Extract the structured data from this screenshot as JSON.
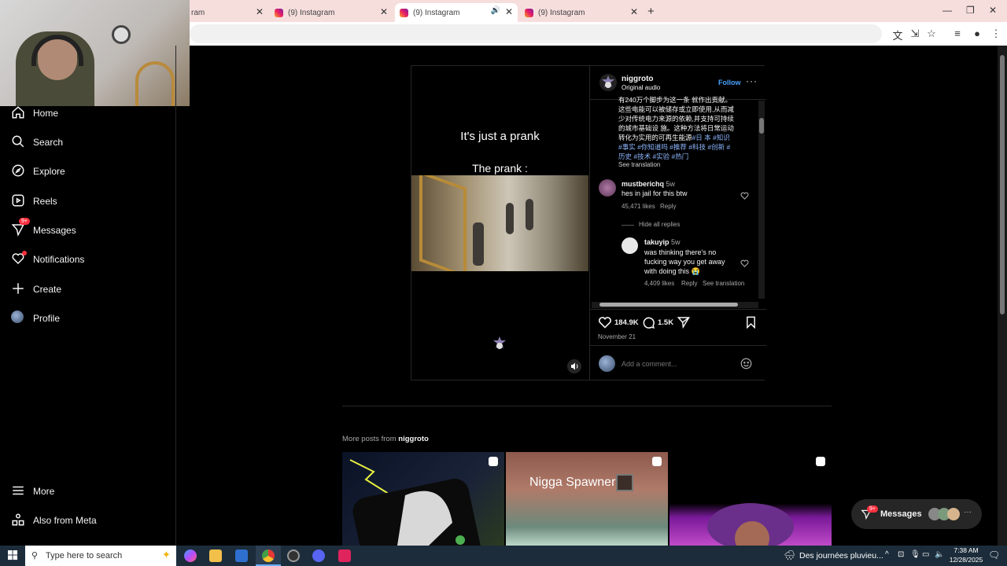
{
  "browser": {
    "tabs": [
      {
        "label": "ram"
      },
      {
        "label": "(9) Instagram"
      },
      {
        "label": "(9) Instagram"
      },
      {
        "label": "(9) Instagram"
      }
    ],
    "new_tab": "+",
    "controls": {
      "minimize": "—",
      "restore": "❐",
      "close": "✕"
    }
  },
  "sidebar": {
    "items": [
      {
        "label": "Home"
      },
      {
        "label": "Search"
      },
      {
        "label": "Explore"
      },
      {
        "label": "Reels"
      },
      {
        "label": "Messages",
        "badge": "9+"
      },
      {
        "label": "Notifications"
      },
      {
        "label": "Create"
      },
      {
        "label": "Profile"
      }
    ],
    "bottom": [
      {
        "label": "More"
      },
      {
        "label": "Also from Meta"
      }
    ]
  },
  "video": {
    "caption1": "It's just a prank",
    "caption2": "The prank :"
  },
  "post": {
    "username": "niggroto",
    "audio": "Original audio",
    "follow": "Follow",
    "caption_lines": [
      "有240万个脚步为这一条 就作出贡献。",
      "这些电能可以被储存或立即使用,从而减",
      "少对传统电力来源的依赖,并支持可持续",
      "的城市基础设 施。这种方法将日常运动",
      "转化为实用的可再生能源"
    ],
    "caption_tags_1": "#日 本 #知识",
    "caption_tags_2": "#事实 #你知道吗 #推荐 #科技 #创新 #",
    "caption_tags_3": "历史 #技术 #实验 #热门",
    "see_translation": "See translation",
    "comments": [
      {
        "user": "mustberichq",
        "time": "5w",
        "text": "hes in jail for this btw",
        "likes": "45,471 likes",
        "reply": "Reply"
      },
      {
        "user": "takuyip",
        "time": "5w",
        "text_lines": [
          "was thinking there's no",
          "fucking way you get away",
          "with doing this 😭"
        ],
        "likes": "4,409 likes",
        "reply": "Reply",
        "translate": "See translation"
      }
    ],
    "hide_replies": "Hide all replies",
    "like_count": "184.9K",
    "comment_count": "1.5K",
    "date": "November 21",
    "add_comment_placeholder": "Add a comment..."
  },
  "more_posts": {
    "prefix": "More posts from ",
    "user": "niggroto",
    "thumb2_text": "Nigga Spawner"
  },
  "floating_messages": {
    "label": "Messages",
    "badge": "9+"
  },
  "taskbar": {
    "search_placeholder": "Type here to search",
    "weather": "Des journées pluvieu...",
    "time": "7:38 AM",
    "date": "12/28/2025"
  }
}
